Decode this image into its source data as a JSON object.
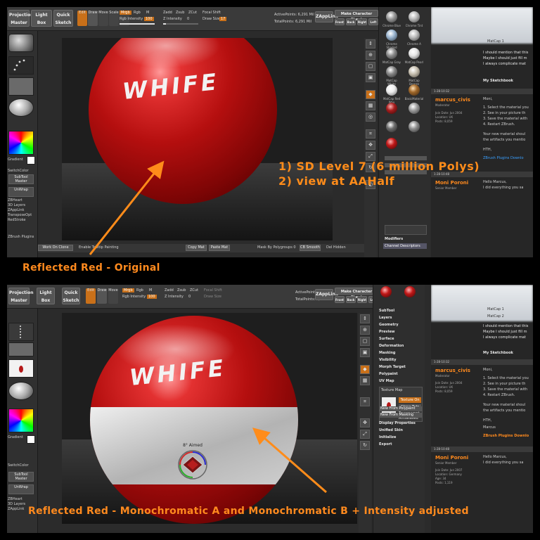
{
  "annotations": {
    "top_caption": "Reflected Red - Original",
    "bottom_caption": "Reflected Red - Monochromatic A and Monochromatic B + Intensity adjusted",
    "notes": [
      "1) SD Level 7 (6 million Polys)",
      "2) view at AAHalf"
    ],
    "accent": "#ff8c1a"
  },
  "zbrush_toolbar": {
    "projection_master": "Projection Master",
    "light_box": "Light Box",
    "quick_sketch": "Quick Sketch",
    "edit": "Edit",
    "draw": "Draw",
    "move": "Move",
    "scale": "Scale",
    "rotate": "Rotate",
    "mrgb": "Mrgb",
    "rgb": "Rgb",
    "m": "M",
    "rgb_intensity_label": "Rgb Intensity",
    "rgb_intensity_value": "100",
    "zadd": "Zadd",
    "zsub": "Zsub",
    "zcut": "ZCut",
    "z_intensity_label": "Z Intensity",
    "z_intensity_value": "0",
    "focal_shift": "Focal Shift",
    "draw_size": "Draw Size",
    "draw_size_value": "17",
    "zapplink": "ZAppLink",
    "make_character_sheet": "Make Character Sheet",
    "views": [
      "Front",
      "Back",
      "Right",
      "Left"
    ]
  },
  "top_panel": {
    "active_points": "ActivePoints: 6,291 Mil",
    "total_points": "TotalPoints: 6,291 Mil"
  },
  "bottom_panel": {
    "active_points": "ActivePoints: 1,609",
    "total_points": "TotalPoints: 1,609"
  },
  "shelf": {
    "standard": "Standard",
    "dots": "Dots",
    "alpha_off": "Alpha Off",
    "texture_off": "Texture Off",
    "gradient": "Gradient",
    "switch_color": "SwitchColor",
    "subtool_master": "SubTool Master",
    "unwrap": "UnWrap",
    "alternate": "Alternate",
    "zbrush_plugins": "ZBrush Plugins",
    "plugin_items": [
      "ZBHeart",
      "3D Layers",
      "ZAppLink",
      "TransposeOpt",
      "RedStroke"
    ]
  },
  "status_bar": {
    "work_on_clone": "Work On Clone",
    "enable_tooltip": "Enable Tooltip Painting",
    "copy_mat": "Copy Mat",
    "paste_mat": "Paste Mat",
    "mask_by_polygroups": "Mask By Polygroups 0",
    "cb_smooth": "CB Smooth",
    "del_hidden": "Del Hidden"
  },
  "materials": {
    "names": [
      "ReflectedRed",
      "Outline Map",
      "Chrome Blue",
      "Chrome Tint",
      "Chrome Shaded",
      "Chrome A",
      "MatCap Gray",
      "MatCap Pearl",
      "MatCap White",
      "MatCap Bronze",
      "MatCap Jade",
      "MatCap Skin",
      "MatCap Red Wax",
      "MatCap Green",
      "MatCap GreenClay",
      "BasicMaterial",
      "Toy Plastic",
      "Chrome B",
      "Chrome C",
      "DoubleShade",
      "Bump Viewer",
      "Skin Shade"
    ],
    "colors": [
      "#c01818",
      "#dddddd",
      "#9db7d1",
      "#bdbdbd",
      "#8e8e8e",
      "#e6e6e6",
      "#888888",
      "#c9c2b3",
      "#eeeeee",
      "#a0682a",
      "#6a8d6a",
      "#c98e72",
      "#a61e1e",
      "#3f6b3f",
      "#7d7a58",
      "#9d9d9d",
      "#d94040",
      "#cfcfcf",
      "#b2b2b2",
      "#6d6d6d",
      "#8f8f8f",
      "#d4a28e"
    ],
    "channel_descriptors": "Channel Descriptors",
    "modifiers": "Modifiers",
    "bottom_menu": [
      "SubTool",
      "Layers",
      "Geometry",
      "Preview",
      "Surface",
      "Deformation",
      "Masking",
      "Visibility",
      "Morph Target",
      "Polypaint",
      "UV Map",
      "Texture Map",
      "Display Properties",
      "Unified Skin",
      "Initialize",
      "Export"
    ],
    "texture_on": "Texture On",
    "clone_txtr": "Clone Txtr",
    "transparent": "Transparent",
    "antialiased": "Antialiased",
    "new_from_polypaint": "New From Polypaint",
    "new_from_masking": "New From Masking"
  },
  "forum": {
    "top_lines": [
      "I should mention that this",
      "Maybe I should just fill m",
      "I always complicate mat"
    ],
    "matcap_1": "MatCap 1",
    "matcap_2": "MatCap 2",
    "my_sketchbook": "My Sketchbook",
    "date_1": "1-28-10:32",
    "user_1": "marcus_civis",
    "user_1_role": "Moderator",
    "user_1_meta": [
      "Join Date: Jun 2004",
      "Location: UK",
      "Posts: 8,059"
    ],
    "post_1_greeting": "Moni,",
    "post_1_steps": [
      "1. Select the material you",
      "2. See in your picture th",
      "3. Save the material with",
      "4. Restart ZBrush."
    ],
    "post_1_more": [
      "Your new material shoul",
      "the artifacts you mentio"
    ],
    "post_1_sign": [
      "HTH,",
      "Marcus"
    ],
    "plugins_link": "ZBrush Plugins Downlo",
    "date_2": "1-28-10:48",
    "user_2": "Moni Poroni",
    "user_2_role": "Senior Member",
    "user_2_meta": [
      "Join Date: Jun 2007",
      "Location: Germany",
      "Age: 34",
      "Posts: 1,119"
    ],
    "post_2": [
      "Hello Marcus,",
      "I did everything you sa"
    ]
  },
  "gizmo": {
    "label": "8° Aimed"
  }
}
